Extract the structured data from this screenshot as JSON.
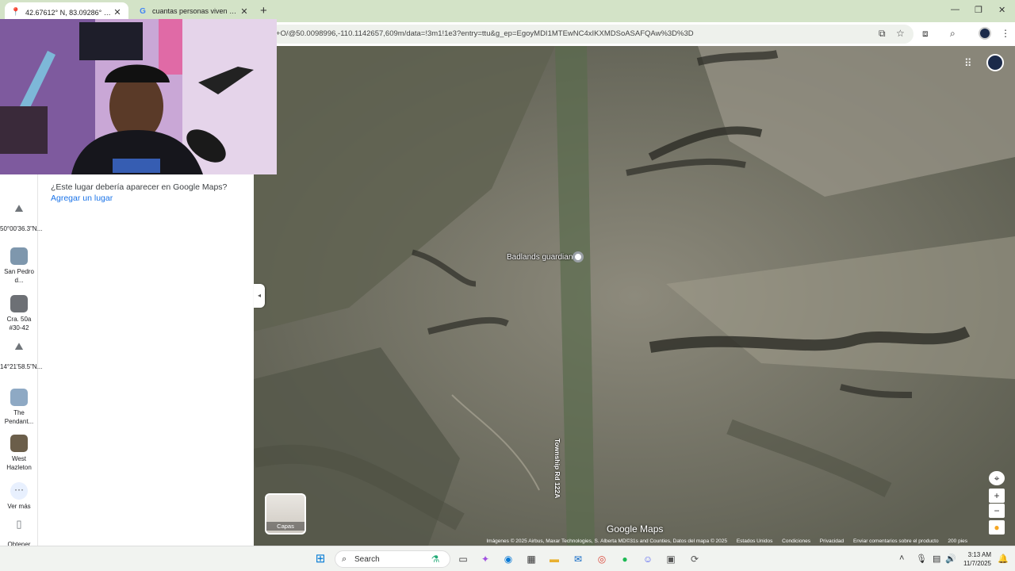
{
  "browser": {
    "tabs": [
      {
        "title": "42.67612° N, 83.09286° O - Go",
        "active": true,
        "favicon": "maps-pin-icon"
      },
      {
        "title": "cuantas personas viven en bog",
        "active": false,
        "favicon": "google-g-icon"
      }
    ],
    "new_tab": "+",
    "url": "+O/@50.0098996,-110.1142657,609m/data=!3m1!1e3?entry=ttu&g_ep=EgoyMDI1MTEwNC4xIKXMDSoASAFQAw%3D%3D"
  },
  "sidebar": {
    "items": [
      {
        "label": "50°00'36.3\"N...",
        "icon": "pin-icon"
      },
      {
        "label": "San Pedro d...",
        "icon": "photo-thumb"
      },
      {
        "label": "Cra. 50a #30-42",
        "icon": "photo-thumb"
      },
      {
        "label": "14°21'58.5\"N...",
        "icon": "pin-icon"
      },
      {
        "label": "The Pendant...",
        "icon": "photo-thumb"
      },
      {
        "label": "West Hazleton",
        "icon": "photo-thumb"
      }
    ],
    "more_label": "Ver más",
    "get_app_label": "Obtener"
  },
  "panel": {
    "question": "¿Este lugar debería aparecer en Google Maps?",
    "add_place": "Agregar un lugar"
  },
  "map": {
    "place_label": "Badlands guardian",
    "road_label": "Township Rd 122A",
    "layers_label": "Capas",
    "brand": "Google Maps",
    "attribution": "Imágenes © 2025 Airbus, Maxar Technologies, S. Alberta MD©31s and Counties, Datos del mapa © 2025",
    "footer_links": [
      "Estados Unidos",
      "Condiciones",
      "Privacidad",
      "Enviar comentarios sobre el producto"
    ],
    "scale": "200 pies"
  },
  "taskbar": {
    "search_placeholder": "Search",
    "time": "3:13 AM",
    "date": "11/7/2025"
  }
}
